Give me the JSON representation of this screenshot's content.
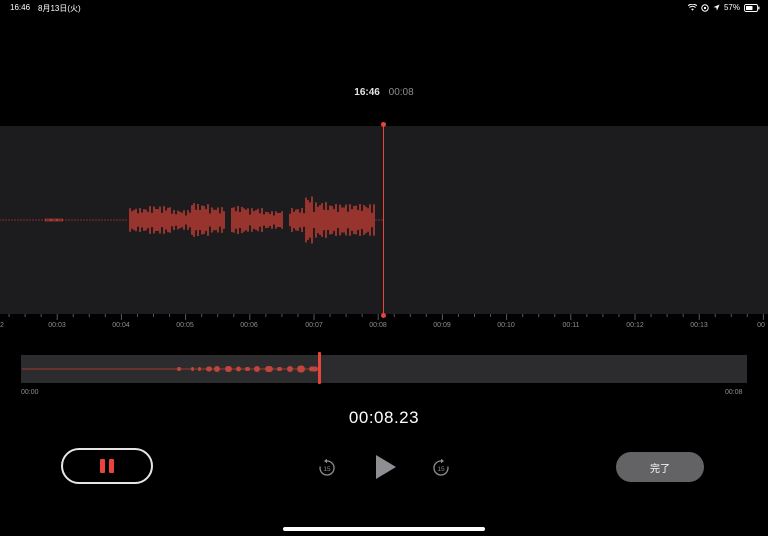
{
  "status_bar": {
    "time": "16:46",
    "date": "8月13日(火)",
    "battery": "57%"
  },
  "recording": {
    "start_time": "16:46",
    "duration": "00:08",
    "current_time": "00:08.23"
  },
  "ruler": {
    "labels": [
      "00:03",
      "00:04",
      "00:05",
      "00:06",
      "00:07",
      "00:08",
      "00:09",
      "00:10",
      "00:11",
      "00:12",
      "00:13"
    ],
    "edge_left": "2",
    "edge_right": "00"
  },
  "overview": {
    "start_label": "00:00",
    "end_label": "00:08"
  },
  "controls": {
    "skip_back_seconds": "15",
    "skip_forward_seconds": "15",
    "done_label": "完了"
  },
  "colors": {
    "accent": "#e9443a",
    "waveform_bg": "#1c1c1e",
    "overview_bg": "#2c2c2e",
    "done_bg": "#636366"
  },
  "icons": {
    "wifi": "wifi-icon",
    "location": "location-icon",
    "battery": "battery-icon",
    "pause": "pause-icon",
    "play": "play-icon",
    "skip_back": "skip-back-15-icon",
    "skip_forward": "skip-forward-15-icon"
  }
}
